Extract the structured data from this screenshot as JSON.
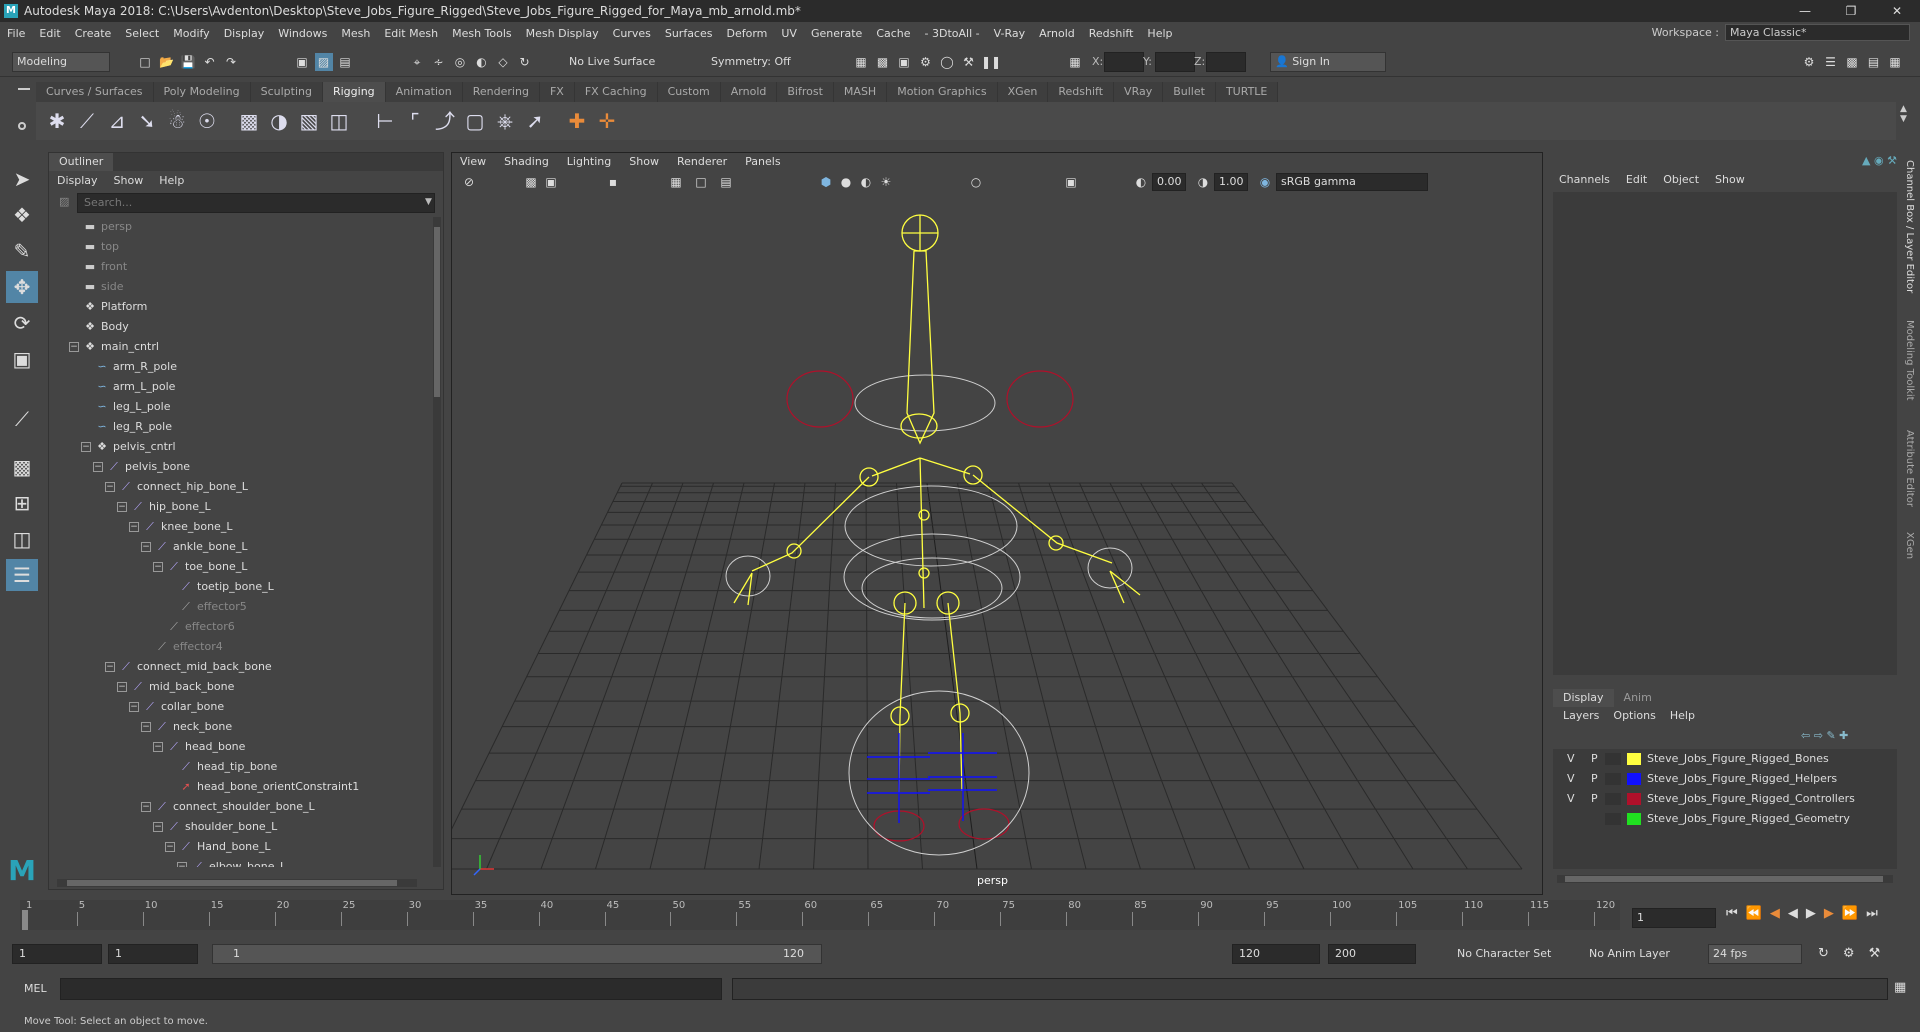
{
  "title": "Autodesk Maya 2018: C:\\Users\\Avdenton\\Desktop\\Steve_Jobs_Figure_Rigged\\Steve_Jobs_Figure_Rigged_for_Maya_mb_arnold.mb*",
  "menu": [
    "File",
    "Edit",
    "Create",
    "Select",
    "Modify",
    "Display",
    "Windows",
    "Mesh",
    "Edit Mesh",
    "Mesh Tools",
    "Mesh Display",
    "Curves",
    "Surfaces",
    "Deform",
    "UV",
    "Generate",
    "Cache",
    "- 3DtoAll -",
    "V-Ray",
    "Arnold",
    "Redshift",
    "Help"
  ],
  "workspace": {
    "label": "Workspace :",
    "value": "Maya Classic*"
  },
  "status": {
    "mode": "Modeling",
    "live_surface": "No Live Surface",
    "symmetry": "Symmetry: Off",
    "x": "X:",
    "y": "Y:",
    "z": "Z:",
    "sign_in": "Sign In"
  },
  "shelf_tabs": [
    "Curves / Surfaces",
    "Poly Modeling",
    "Sculpting",
    "Rigging",
    "Animation",
    "Rendering",
    "FX",
    "FX Caching",
    "Custom",
    "Arnold",
    "Bifrost",
    "MASH",
    "Motion Graphics",
    "XGen",
    "Redshift",
    "VRay",
    "Bullet",
    "TURTLE"
  ],
  "active_shelf": "Rigging",
  "outliner": {
    "tab": "Outliner",
    "menu": [
      "Display",
      "Show",
      "Help"
    ],
    "search_placeholder": "Search...",
    "rows": [
      {
        "label": "persp",
        "depth": 1,
        "icon": "camera-icon",
        "dim": true
      },
      {
        "label": "top",
        "depth": 1,
        "icon": "camera-icon",
        "dim": true
      },
      {
        "label": "front",
        "depth": 1,
        "icon": "camera-icon",
        "dim": true
      },
      {
        "label": "side",
        "depth": 1,
        "icon": "camera-icon",
        "dim": true
      },
      {
        "label": "Platform",
        "depth": 1,
        "icon": "group-icon",
        "dim": false
      },
      {
        "label": "Body",
        "depth": 1,
        "icon": "group-icon",
        "dim": false
      },
      {
        "label": "main_cntrl",
        "depth": 1,
        "icon": "group-icon",
        "dim": false,
        "expander": true
      },
      {
        "label": "arm_R_pole",
        "depth": 2,
        "icon": "curve-icon",
        "dim": false
      },
      {
        "label": "arm_L_pole",
        "depth": 2,
        "icon": "curve-icon",
        "dim": false
      },
      {
        "label": "leg_L_pole",
        "depth": 2,
        "icon": "curve-icon",
        "dim": false
      },
      {
        "label": "leg_R_pole",
        "depth": 2,
        "icon": "curve-icon",
        "dim": false
      },
      {
        "label": "pelvis_cntrl",
        "depth": 2,
        "icon": "group-icon",
        "dim": false,
        "expander": true
      },
      {
        "label": "pelvis_bone",
        "depth": 3,
        "icon": "joint-icon",
        "dim": false,
        "expander": true
      },
      {
        "label": "connect_hip_bone_L",
        "depth": 4,
        "icon": "joint-icon",
        "dim": false,
        "expander": true
      },
      {
        "label": "hip_bone_L",
        "depth": 5,
        "icon": "joint-icon",
        "dim": false,
        "expander": true
      },
      {
        "label": "knee_bone_L",
        "depth": 6,
        "icon": "joint-icon",
        "dim": false,
        "expander": true
      },
      {
        "label": "ankle_bone_L",
        "depth": 7,
        "icon": "joint-icon",
        "dim": false,
        "expander": true
      },
      {
        "label": "toe_bone_L",
        "depth": 8,
        "icon": "joint-icon",
        "dim": false,
        "expander": true
      },
      {
        "label": "toetip_bone_L",
        "depth": 9,
        "icon": "joint-icon",
        "dim": false
      },
      {
        "label": "effector5",
        "depth": 9,
        "icon": "effector-icon",
        "dim": true
      },
      {
        "label": "effector6",
        "depth": 8,
        "icon": "effector-icon",
        "dim": true
      },
      {
        "label": "effector4",
        "depth": 7,
        "icon": "effector-icon",
        "dim": true
      },
      {
        "label": "connect_mid_back_bone",
        "depth": 4,
        "icon": "joint-icon",
        "dim": false,
        "expander": true
      },
      {
        "label": "mid_back_bone",
        "depth": 5,
        "icon": "joint-icon",
        "dim": false,
        "expander": true
      },
      {
        "label": "collar_bone",
        "depth": 6,
        "icon": "joint-icon",
        "dim": false,
        "expander": true
      },
      {
        "label": "neck_bone",
        "depth": 7,
        "icon": "joint-icon",
        "dim": false,
        "expander": true
      },
      {
        "label": "head_bone",
        "depth": 8,
        "icon": "joint-icon",
        "dim": false,
        "expander": true
      },
      {
        "label": "head_tip_bone",
        "depth": 9,
        "icon": "joint-icon",
        "dim": false
      },
      {
        "label": "head_bone_orientConstraint1",
        "depth": 9,
        "icon": "constraint-icon",
        "dim": false
      },
      {
        "label": "connect_shoulder_bone_L",
        "depth": 7,
        "icon": "joint-icon",
        "dim": false,
        "expander": true
      },
      {
        "label": "shoulder_bone_L",
        "depth": 8,
        "icon": "joint-icon",
        "dim": false,
        "expander": true
      },
      {
        "label": "Hand_bone_L",
        "depth": 9,
        "icon": "joint-icon",
        "dim": false,
        "expander": true
      },
      {
        "label": "elbow_bone_L",
        "depth": 10,
        "icon": "joint-icon",
        "dim": false,
        "expander": true
      }
    ]
  },
  "viewport": {
    "menu": [
      "View",
      "Shading",
      "Lighting",
      "Show",
      "Renderer",
      "Panels"
    ],
    "exposure": "0.00",
    "gamma": "1.00",
    "color_space": "sRGB gamma",
    "camera_label": "persp"
  },
  "channel_box": {
    "menu": [
      "Channels",
      "Edit",
      "Object",
      "Show"
    ],
    "layer_tabs": [
      "Display",
      "Anim"
    ],
    "layer_menu": [
      "Layers",
      "Options",
      "Help"
    ],
    "layers": [
      {
        "v": "V",
        "p": "P",
        "name": "Steve_Jobs_Figure_Rigged_Bones",
        "color": "#ffff40"
      },
      {
        "v": "V",
        "p": "P",
        "name": "Steve_Jobs_Figure_Rigged_Helpers",
        "color": "#1010ff"
      },
      {
        "v": "V",
        "p": "P",
        "name": "Steve_Jobs_Figure_Rigged_Controllers",
        "color": "#b0102a"
      },
      {
        "v": "",
        "p": "",
        "name": "Steve_Jobs_Figure_Rigged_Geometry",
        "color": "#20e020"
      }
    ]
  },
  "side_tabs": [
    "Channel Box / Layer Editor",
    "Modeling Toolkit",
    "Attribute Editor",
    "XGen"
  ],
  "timeline": {
    "ticks": [
      "1",
      "5",
      "10",
      "15",
      "20",
      "25",
      "30",
      "35",
      "40",
      "45",
      "50",
      "55",
      "60",
      "65",
      "70",
      "75",
      "80",
      "85",
      "90",
      "95",
      "100",
      "105",
      "110",
      "115",
      "120"
    ],
    "current_frame": "1",
    "range_start": "1",
    "anim_start": "1",
    "range_slider_start": "1",
    "range_slider_end": "120",
    "range_end": "120",
    "anim_end": "200",
    "character_set": "No Character Set",
    "anim_layer": "No Anim Layer",
    "fps": "24 fps"
  },
  "command_line": {
    "label": "MEL"
  },
  "help_line": "Move Tool: Select an object to move."
}
